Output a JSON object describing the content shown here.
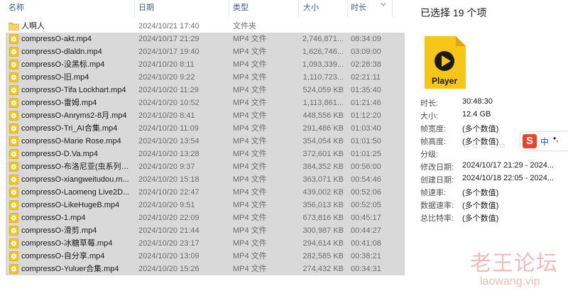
{
  "header": {
    "name": "名称",
    "date": "日期",
    "type": "类型",
    "size": "大小",
    "duration": "时长"
  },
  "folder": {
    "name": "人啊人",
    "date": "2024/10/21 17:40",
    "type": "文件夹"
  },
  "files": [
    {
      "name": "compressO-akt.mp4",
      "date": "2024/10/17 21:29",
      "type": "MP4 文件",
      "size": "2,746,871...",
      "duration": "08:34:09"
    },
    {
      "name": "compressO-dlaldn.mp4",
      "date": "2024/10/17 19:40",
      "type": "MP4 文件",
      "size": "1,626,746...",
      "duration": "03:09:00"
    },
    {
      "name": "compressO-没黑标.mp4",
      "date": "2024/10/20 8:11",
      "type": "MP4 文件",
      "size": "1,093,339...",
      "duration": "02:28:38"
    },
    {
      "name": "compressO-旧.mp4",
      "date": "2024/10/20 9:22",
      "type": "MP4 文件",
      "size": "1,110,723...",
      "duration": "02:21:11"
    },
    {
      "name": "compressO-Tifa Lockhart.mp4",
      "date": "2024/10/20 11:29",
      "type": "MP4 文件",
      "size": "524,059 KB",
      "duration": "01:35:40"
    },
    {
      "name": "compressO-雷姆.mp4",
      "date": "2024/10/20 10:52",
      "type": "MP4 文件",
      "size": "1,113,861...",
      "duration": "01:21:46"
    },
    {
      "name": "compressO-Anryms2-8月.mp4",
      "date": "2024/10/20 8:41",
      "type": "MP4 文件",
      "size": "448,556 KB",
      "duration": "01:12:20"
    },
    {
      "name": "compressO-Tri_AI合集.mp4",
      "date": "2024/10/20 11:09",
      "type": "MP4 文件",
      "size": "291,486 KB",
      "duration": "01:03:40"
    },
    {
      "name": "compressO-Marie Rose.mp4",
      "date": "2024/10/20 13:54",
      "type": "MP4 文件",
      "size": "354,054 KB",
      "duration": "01:01:50"
    },
    {
      "name": "compressO-D.Va.mp4",
      "date": "2024/10/20 13:28",
      "type": "MP4 文件",
      "size": "372,601 KB",
      "duration": "01:01:25"
    },
    {
      "name": "compressO-布洛尼亚(虫系列重...",
      "date": "2024/10/20 9:37",
      "type": "MP4 文件",
      "size": "384,352 KB",
      "duration": "00:56:00"
    },
    {
      "name": "compressO-xiangweitudou.m...",
      "date": "2024/10/20 15:18",
      "type": "MP4 文件",
      "size": "363,071 KB",
      "duration": "00:54:46"
    },
    {
      "name": "compressO-Laomeng Live2D...",
      "date": "2024/10/20 22:47",
      "type": "MP4 文件",
      "size": "439,002 KB",
      "duration": "00:52:06"
    },
    {
      "name": "compressO-LikeHugeB.mp4",
      "date": "2024/10/20 9:51",
      "type": "MP4 文件",
      "size": "356,013 KB",
      "duration": "00:52:05"
    },
    {
      "name": "compressO-1.mp4",
      "date": "2024/10/20 22:09",
      "type": "MP4 文件",
      "size": "673,816 KB",
      "duration": "00:45:17"
    },
    {
      "name": "compressO-滑剪.mp4",
      "date": "2024/10/20 21:44",
      "type": "MP4 文件",
      "size": "300,987 KB",
      "duration": "00:44:27"
    },
    {
      "name": "compressO-冰糖草莓.mp4",
      "date": "2024/10/20 23:17",
      "type": "MP4 文件",
      "size": "294,614 KB",
      "duration": "00:41:08"
    },
    {
      "name": "compressO-自分享.mp4",
      "date": "2024/10/20 13:09",
      "type": "MP4 文件",
      "size": "282,585 KB",
      "duration": "00:38:21"
    },
    {
      "name": "compressO-Yuluer合集.mp4",
      "date": "2024/10/20 15:26",
      "type": "MP4 文件",
      "size": "274,432 KB",
      "duration": "00:34:31"
    }
  ],
  "details": {
    "selected_title": "已选择 19 个项",
    "thumb_label": "Player",
    "props": [
      {
        "label": "时长:",
        "value": "30:48:30"
      },
      {
        "label": "大小:",
        "value": "12.4 GB"
      },
      {
        "label": "帧宽度:",
        "value": "(多个数值)"
      },
      {
        "label": "帧高度:",
        "value": "(多个数值)"
      },
      {
        "label": "分级:",
        "value": ""
      },
      {
        "label": "修改日期:",
        "value": "2024/10/17 21:29 - 2024..."
      },
      {
        "label": "创建日期:",
        "value": "2024/10/18 22:05 - 2024..."
      },
      {
        "label": "帧速率:",
        "value": "(多个数值)"
      },
      {
        "label": "数据速率:",
        "value": "(多个数值)"
      },
      {
        "label": "总比特率:",
        "value": "(多个数值)"
      }
    ],
    "rating_stars": "☆☆☆☆☆"
  },
  "ime": {
    "logo": "S",
    "mode": "中",
    "punct": "•,"
  },
  "watermark": {
    "cn": "老王论坛",
    "en": "laowang.vip"
  },
  "colors": {
    "selection": "#d9d9d9",
    "folder": "#f4c24d",
    "video_icon": "#f5c518",
    "header_text": "#4c607a",
    "watermark": "#d03c3c"
  }
}
